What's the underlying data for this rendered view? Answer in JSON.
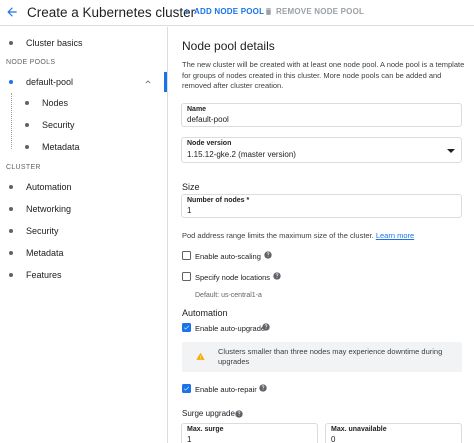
{
  "header": {
    "title": "Create a Kubernetes cluster",
    "add_node_pool": "ADD NODE POOL",
    "remove_node_pool": "REMOVE NODE POOL"
  },
  "sidebar": {
    "cluster_basics": "Cluster basics",
    "node_pools_heading": "NODE POOLS",
    "default_pool": "default-pool",
    "nodes": "Nodes",
    "security": "Security",
    "metadata_pool": "Metadata",
    "cluster_heading": "CLUSTER",
    "automation": "Automation",
    "networking": "Networking",
    "cluster_security": "Security",
    "cluster_metadata": "Metadata",
    "features": "Features"
  },
  "main": {
    "title": "Node pool details",
    "description": "The new cluster will be created with at least one node pool. A node pool is a template for groups of nodes created in this cluster. More node pools can be added and removed after cluster creation.",
    "name_label": "Name",
    "name_value": "default-pool",
    "version_label": "Node version",
    "version_value": "1.15.12-gke.2 (master version)",
    "size_heading": "Size",
    "nodes_label": "Number of nodes *",
    "nodes_value": "1",
    "pod_text": "Pod address range limits the maximum size of the cluster.",
    "learn_more": "Learn more",
    "auto_scaling": "Enable auto-scaling",
    "node_locations": "Specify node locations",
    "default_location": "Default: us-central1-a",
    "automation_heading": "Automation",
    "auto_upgrade": "Enable auto-upgrade",
    "warning": "Clusters smaller than three nodes may experience downtime during upgrades",
    "auto_repair": "Enable auto-repair",
    "surge_heading": "Surge upgrade",
    "max_surge_label": "Max. surge",
    "max_surge_value": "1",
    "max_unavailable_label": "Max. unavailable",
    "max_unavailable_value": "0"
  },
  "state": {
    "auto_scaling_checked": false,
    "node_locations_checked": false,
    "auto_upgrade_checked": true,
    "auto_repair_checked": true
  },
  "colors": {
    "accent": "#1a73e8",
    "warning": "#f9ab00"
  },
  "icons": [
    "arrow-back-icon",
    "add-icon",
    "trash-icon",
    "chevron-up-icon",
    "help-icon",
    "warning-icon",
    "check-icon"
  ]
}
